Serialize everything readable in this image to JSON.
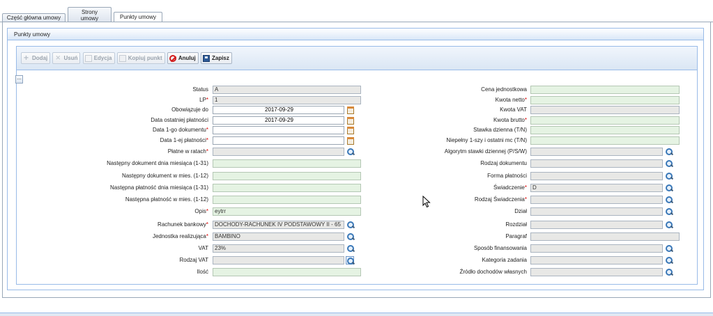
{
  "tabs": [
    {
      "label": "Część główna umowy"
    },
    {
      "label_line1": "Strony",
      "label_line2": "umowy"
    },
    {
      "label": "Punkty umowy"
    }
  ],
  "panel": {
    "title": "Punkty umowy"
  },
  "toolbar": {
    "add": "Dodaj",
    "delete": "Usuń",
    "edit": "Edycja",
    "copy": "Kopiuj punkt",
    "cancel": "Anuluj",
    "save": "Zapisz"
  },
  "collapse_label": "...",
  "left": {
    "status": {
      "label": "Status",
      "value": "A"
    },
    "lp": {
      "label": "LP",
      "value": "1"
    },
    "obowiazuje_do": {
      "label": "Obowiązuje do",
      "value": "2017-09-29"
    },
    "data_ost_platnosci": {
      "label": "Data ostatniej płatności",
      "value": "2017-09-29"
    },
    "data_1_dok": {
      "label": "Data 1-go dokumentu",
      "value": ""
    },
    "data_1_platnosci": {
      "label": "Data 1-ej płatności",
      "value": ""
    },
    "platne_w_ratach": {
      "label": "Płatne w ratach",
      "value": ""
    },
    "nast_dok_dnia": {
      "label": "Następny dokument dnia miesiąca (1-31)",
      "value": ""
    },
    "nast_dok_mies": {
      "label": "Następny dokument w mies. (1-12)",
      "value": ""
    },
    "nast_plat_dnia": {
      "label": "Następna płatność dnia miesiąca (1-31)",
      "value": ""
    },
    "nast_plat_mies": {
      "label": "Następna płatność w mies. (1-12)",
      "value": ""
    },
    "opis": {
      "label": "Opis",
      "value": "eytrr"
    },
    "rachunek": {
      "label": "Rachunek bankowy",
      "value": "DOCHODY-RACHUNEK IV PODSTAWOWY II - 65"
    },
    "jednostka": {
      "label": "Jednostka realizująca",
      "value": "BAMBINO"
    },
    "vat": {
      "label": "VAT",
      "value": "23%"
    },
    "rodzaj_vat": {
      "label": "Rodzaj VAT",
      "value": ""
    },
    "ilosc": {
      "label": "Ilość",
      "value": ""
    }
  },
  "right": {
    "cena_jedn": {
      "label": "Cena jednostkowa",
      "value": ""
    },
    "kwota_netto": {
      "label": "Kwota netto",
      "value": ""
    },
    "kwota_vat": {
      "label": "Kwota VAT",
      "value": ""
    },
    "kwota_brutto": {
      "label": "Kwota brutto",
      "value": ""
    },
    "stawka_dzienna": {
      "label": "Stawka dzienna (T/N)",
      "value": ""
    },
    "niepelny": {
      "label": "Niepełny 1-szy i ostatni mc (T/N)",
      "value": ""
    },
    "algorytm": {
      "label": "Algorytm stawki dziennej (P/S/W)",
      "value": ""
    },
    "rodzaj_dok": {
      "label": "Rodzaj dokumentu",
      "value": ""
    },
    "forma_plat": {
      "label": "Forma płatności",
      "value": ""
    },
    "swiadczenie": {
      "label": "Świadczenie",
      "value": "D"
    },
    "rodzaj_swiad": {
      "label": "Rodzaj Świadczenia",
      "value": ""
    },
    "dzial": {
      "label": "Dział",
      "value": ""
    },
    "rozdzial": {
      "label": "Rozdział",
      "value": ""
    },
    "paragraf": {
      "label": "Paragraf",
      "value": ""
    },
    "sposob_fin": {
      "label": "Sposób finansowania",
      "value": ""
    },
    "kategoria": {
      "label": "Kategoria zadania",
      "value": ""
    },
    "zrodlo": {
      "label": "Źródło dochodów własnych",
      "value": ""
    }
  },
  "required_mark": "*"
}
